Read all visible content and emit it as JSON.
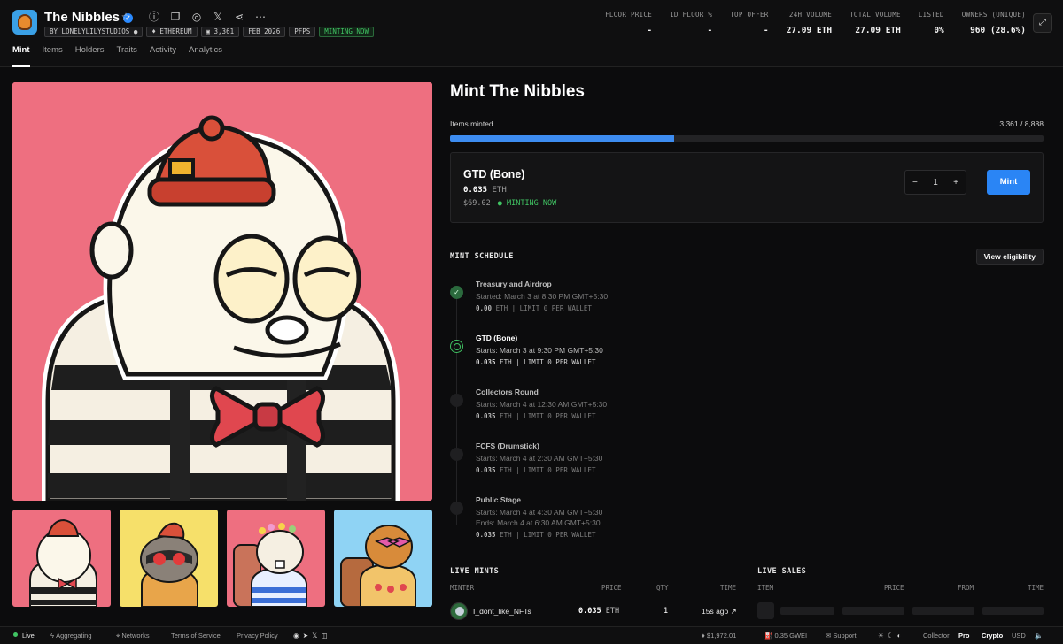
{
  "collection": {
    "name": "The Nibbles",
    "tags": {
      "creator": "BY LONELYLILYSTUDIOS",
      "chain": "ETHEREUM",
      "items": "3,361",
      "date": "FEB 2026",
      "category": "PFPS",
      "status": "MINTING NOW"
    }
  },
  "stats": [
    {
      "label": "FLOOR PRICE",
      "value": "-"
    },
    {
      "label": "1D FLOOR %",
      "value": "-"
    },
    {
      "label": "TOP OFFER",
      "value": "-"
    },
    {
      "label": "24H VOLUME",
      "value": "27.09 ETH"
    },
    {
      "label": "TOTAL VOLUME",
      "value": "27.09 ETH"
    },
    {
      "label": "LISTED",
      "value": "0%"
    },
    {
      "label": "OWNERS (UNIQUE)",
      "value": "960 (28.6%)"
    }
  ],
  "tabs": [
    "Mint",
    "Items",
    "Holders",
    "Traits",
    "Activity",
    "Analytics"
  ],
  "mint": {
    "title": "Mint The Nibbles",
    "items_minted_label": "Items minted",
    "items_minted_value": "3,361 / 8,888",
    "progress_fraction": 0.378,
    "current_stage": {
      "name": "GTD (Bone)",
      "price": "0.035",
      "currency": "ETH",
      "usd": "$69.02",
      "status": "MINTING NOW",
      "quantity": "1",
      "mint_button": "Mint"
    },
    "schedule_title": "MINT SCHEDULE",
    "eligibility_button": "View eligibility",
    "stages": [
      {
        "name": "Treasury and Airdrop",
        "line1": "Started: March 3 at 8:30 PM GMT+5:30",
        "line2": "",
        "price": "0.00",
        "meta": "ETH | LIMIT 0 PER WALLET"
      },
      {
        "name": "GTD (Bone)",
        "line1": "Starts: March 3 at 9:30 PM GMT+5:30",
        "line2": "",
        "price": "0.035",
        "meta": "ETH | LIMIT 0 PER WALLET"
      },
      {
        "name": "Collectors Round",
        "line1": "Starts: March 4 at 12:30 AM GMT+5:30",
        "line2": "",
        "price": "0.035",
        "meta": "ETH | LIMIT 0 PER WALLET"
      },
      {
        "name": "FCFS (Drumstick)",
        "line1": "Starts: March 4 at 2:30 AM GMT+5:30",
        "line2": "",
        "price": "0.035",
        "meta": "ETH | LIMIT 0 PER WALLET"
      },
      {
        "name": "Public Stage",
        "line1": "Starts: March 4 at 4:30 AM GMT+5:30",
        "line2": "Ends: March 4 at 6:30 AM GMT+5:30",
        "price": "0.035",
        "meta": "ETH | LIMIT 0 PER WALLET"
      }
    ]
  },
  "live_mints": {
    "title": "LIVE MINTS",
    "columns": [
      "MINTER",
      "PRICE",
      "QTY",
      "TIME"
    ],
    "rows": [
      {
        "minter": "I_dont_like_NFTs",
        "price": "0.035",
        "currency": "ETH",
        "qty": "1",
        "time": "15s ago"
      }
    ]
  },
  "live_sales": {
    "title": "LIVE SALES",
    "columns": [
      "ITEM",
      "PRICE",
      "FROM",
      "TIME"
    ]
  },
  "footer": {
    "live": "Live",
    "aggregating": "Aggregating",
    "networks": "Networks",
    "terms": "Terms of Service",
    "privacy": "Privacy Policy",
    "eth_price": "$1,972.01",
    "gas": "0.35 GWEI",
    "support": "Support",
    "mode_collector": "Collector",
    "mode_pro": "Pro",
    "currency_crypto": "Crypto",
    "currency_usd": "USD"
  },
  "colors": {
    "accent_blue": "#2a85f5",
    "live_green": "#40c463",
    "hero_bg": "#ee6f80"
  }
}
